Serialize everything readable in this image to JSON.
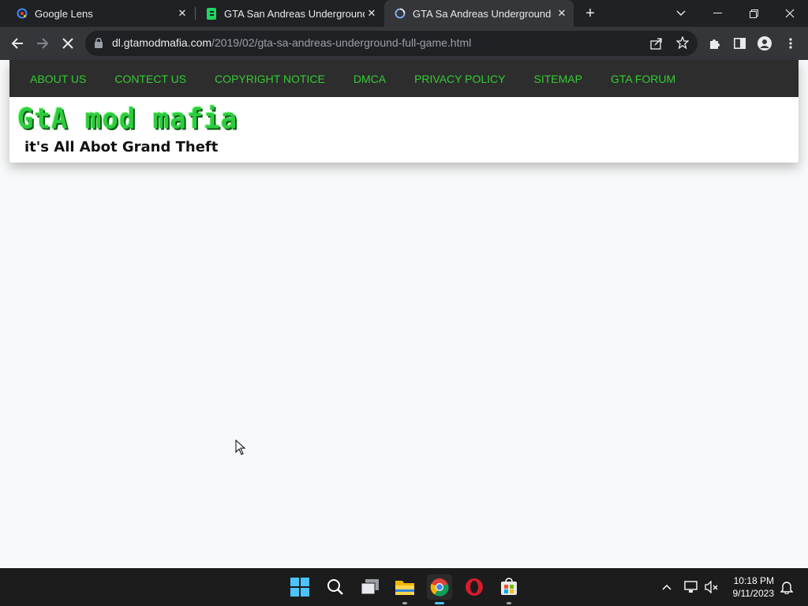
{
  "browser": {
    "tabs": [
      {
        "title": "Google Lens",
        "icon": "google-lens-icon",
        "active": false
      },
      {
        "title": "GTA San Andreas Underground F",
        "icon": "green-page-icon",
        "active": false
      },
      {
        "title": "GTA Sa Andreas Underground Fu",
        "icon": "loading-globe-icon",
        "active": true
      }
    ],
    "url_host": "dl.gtamodmafia.com",
    "url_path": "/2019/02/gta-sa-andreas-underground-full-game.html"
  },
  "site": {
    "nav": [
      "ABOUT US",
      "CONTECT US",
      "COPYRIGHT NOTICE",
      "DMCA",
      "PRIVACY POLICY",
      "SITEMAP",
      "GTA FORUM"
    ],
    "logo_title": "GtA mod mafia",
    "logo_tagline": "it's All Abot Grand  Theft",
    "nav_color": "#33cc33"
  },
  "taskbar": {
    "time": "10:18 PM",
    "date": "9/11/2023"
  }
}
